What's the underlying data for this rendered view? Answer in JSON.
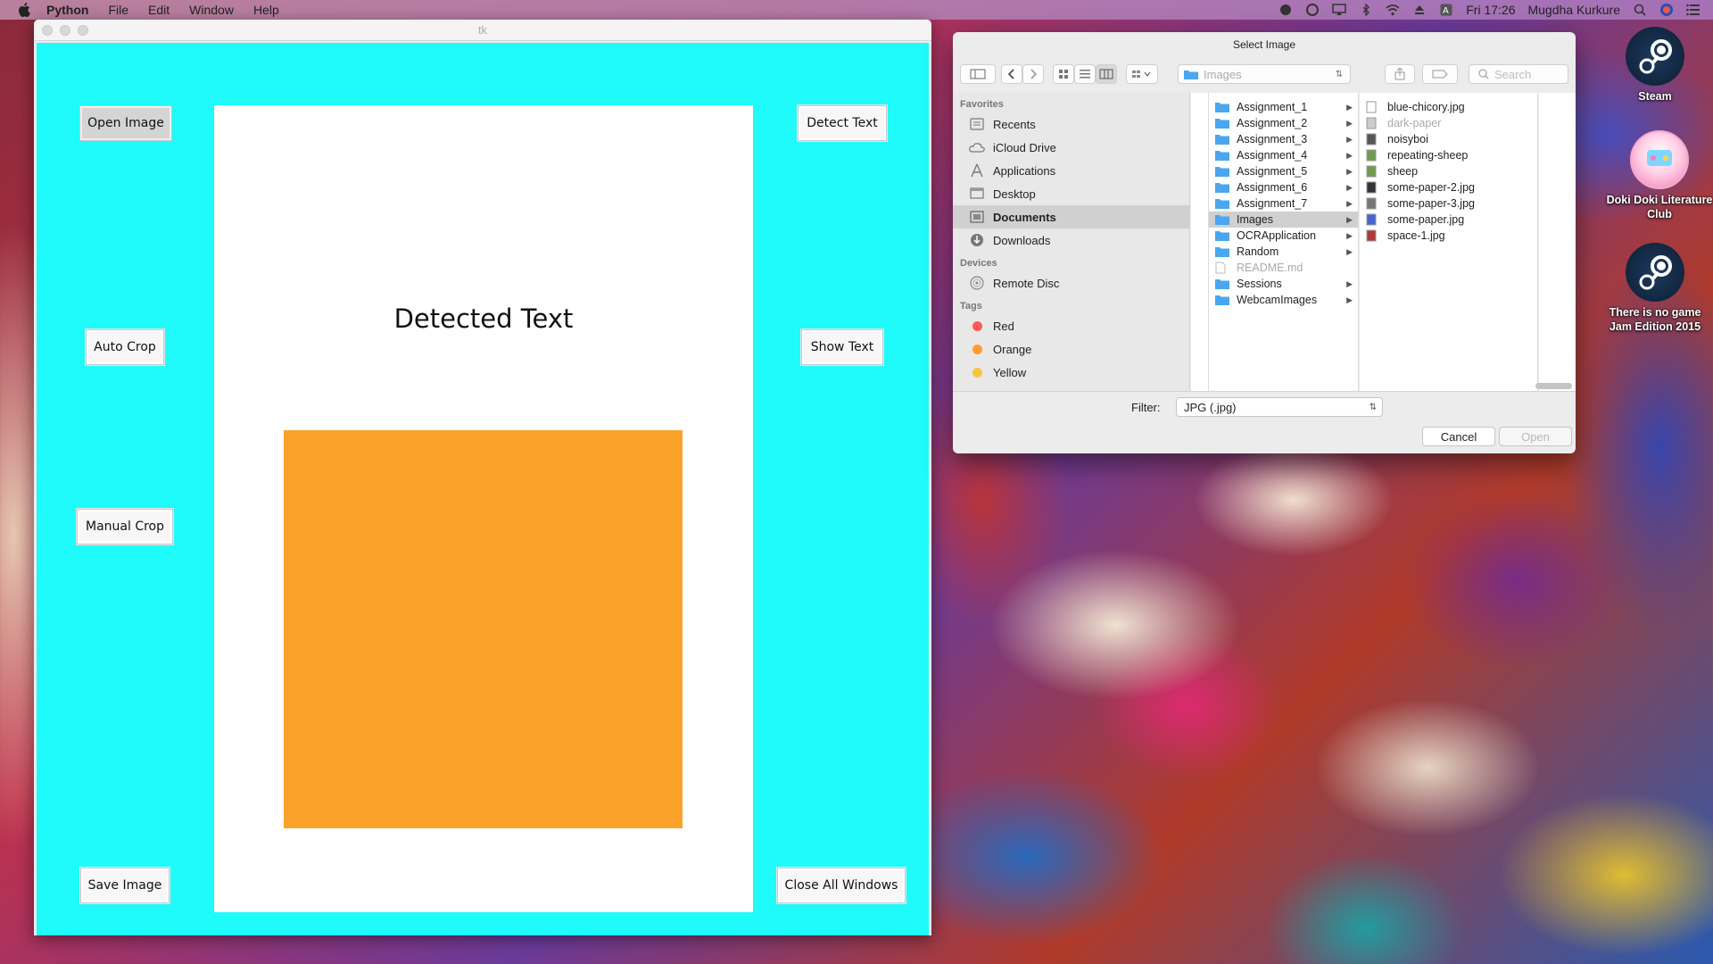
{
  "menubar": {
    "app": "Python",
    "items": [
      "File",
      "Edit",
      "Window",
      "Help"
    ],
    "clock": "Fri 17:26",
    "user": "Mugdha Kurkure"
  },
  "tk": {
    "title": "tk",
    "buttons": {
      "open_image": "Open Image",
      "detect_text": "Detect Text",
      "auto_crop": "Auto Crop",
      "show_text": "Show Text",
      "manual_crop": "Manual Crop",
      "save_image": "Save Image",
      "close_all": "Close All Windows"
    },
    "canvas_title": "Detected Text",
    "colors": {
      "background": "#1ffafa",
      "image": "#fba22a"
    }
  },
  "dialog": {
    "title": "Select Image",
    "path": "Images",
    "search_placeholder": "Search",
    "sidebar": {
      "favorites_header": "Favorites",
      "favorites": [
        "Recents",
        "iCloud Drive",
        "Applications",
        "Desktop",
        "Documents",
        "Downloads"
      ],
      "devices_header": "Devices",
      "devices": [
        "Remote Disc"
      ],
      "tags_header": "Tags",
      "tags": [
        {
          "name": "Red",
          "color": "#ff5a52"
        },
        {
          "name": "Orange",
          "color": "#ff9b30"
        },
        {
          "name": "Yellow",
          "color": "#f5c740"
        }
      ]
    },
    "folders": [
      "Assignment_1",
      "Assignment_2",
      "Assignment_3",
      "Assignment_4",
      "Assignment_5",
      "Assignment_6",
      "Assignment_7",
      "Images",
      "OCRApplication",
      "Random",
      "README.md",
      "Sessions",
      "WebcamImages"
    ],
    "files": [
      "blue-chicory.jpg",
      "dark-paper",
      "noisyboi",
      "repeating-sheep",
      "sheep",
      "some-paper-2.jpg",
      "some-paper-3.jpg",
      "some-paper.jpg",
      "space-1.jpg"
    ],
    "filter_label": "Filter:",
    "filter_value": "JPG (.jpg)",
    "cancel": "Cancel",
    "open": "Open"
  },
  "desktop_icons": [
    "Steam",
    "Doki Doki Literature Club",
    "There is no game Jam Edition 2015"
  ]
}
